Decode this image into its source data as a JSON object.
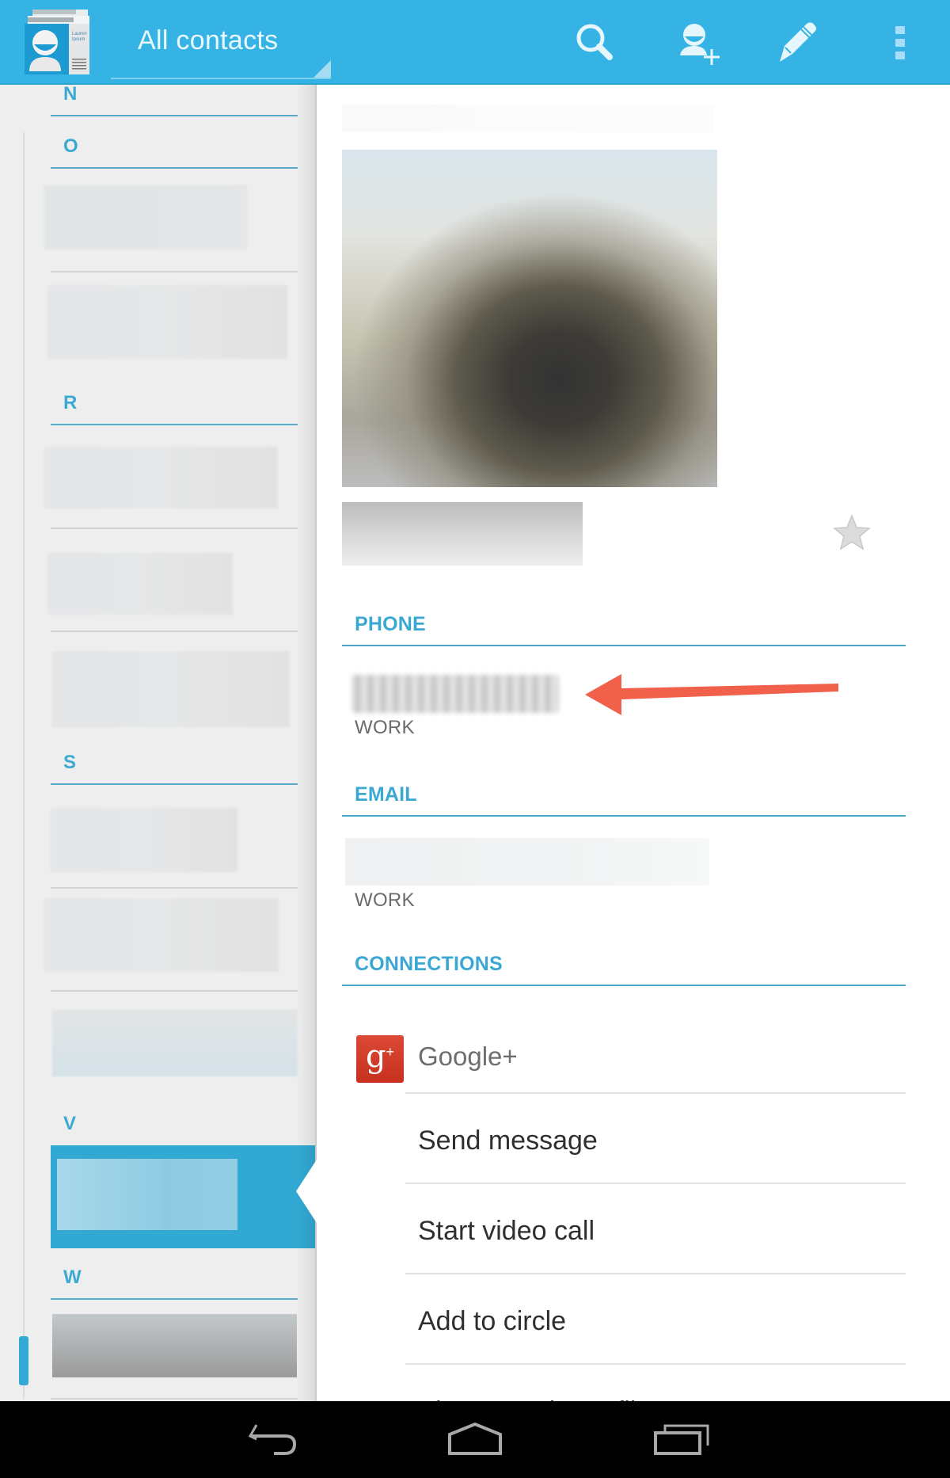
{
  "action_bar": {
    "title": "All contacts",
    "app_icon": "contacts-app-icon",
    "actions": [
      {
        "name": "search",
        "icon": "search-icon"
      },
      {
        "name": "add-contact",
        "icon": "add-person-icon"
      },
      {
        "name": "edit",
        "icon": "pencil-icon"
      },
      {
        "name": "overflow-menu",
        "icon": "more-vertical-icon"
      }
    ],
    "accent_color": "#35b3e4"
  },
  "contact_list": {
    "sections": [
      "N",
      "O",
      "R",
      "S",
      "V",
      "W"
    ],
    "selected_section": "V",
    "contact_names_redacted": true
  },
  "contact_detail": {
    "name_redacted": true,
    "photo_redacted": true,
    "starred": false,
    "phone": {
      "header": "PHONE",
      "value_redacted": true,
      "type": "WORK"
    },
    "email": {
      "header": "EMAIL",
      "value_redacted": true,
      "type": "WORK"
    },
    "connections": {
      "header": "CONNECTIONS",
      "service": "Google+",
      "actions": [
        "Send message",
        "Start video call",
        "Add to circle",
        "View Google profile"
      ]
    },
    "annotation": {
      "type": "arrow",
      "points_to": "phone-number",
      "color": "#f0604b"
    }
  },
  "nav_bar": {
    "buttons": [
      {
        "name": "back",
        "icon": "back-icon"
      },
      {
        "name": "home",
        "icon": "home-icon"
      },
      {
        "name": "recents",
        "icon": "recent-apps-icon"
      }
    ]
  }
}
